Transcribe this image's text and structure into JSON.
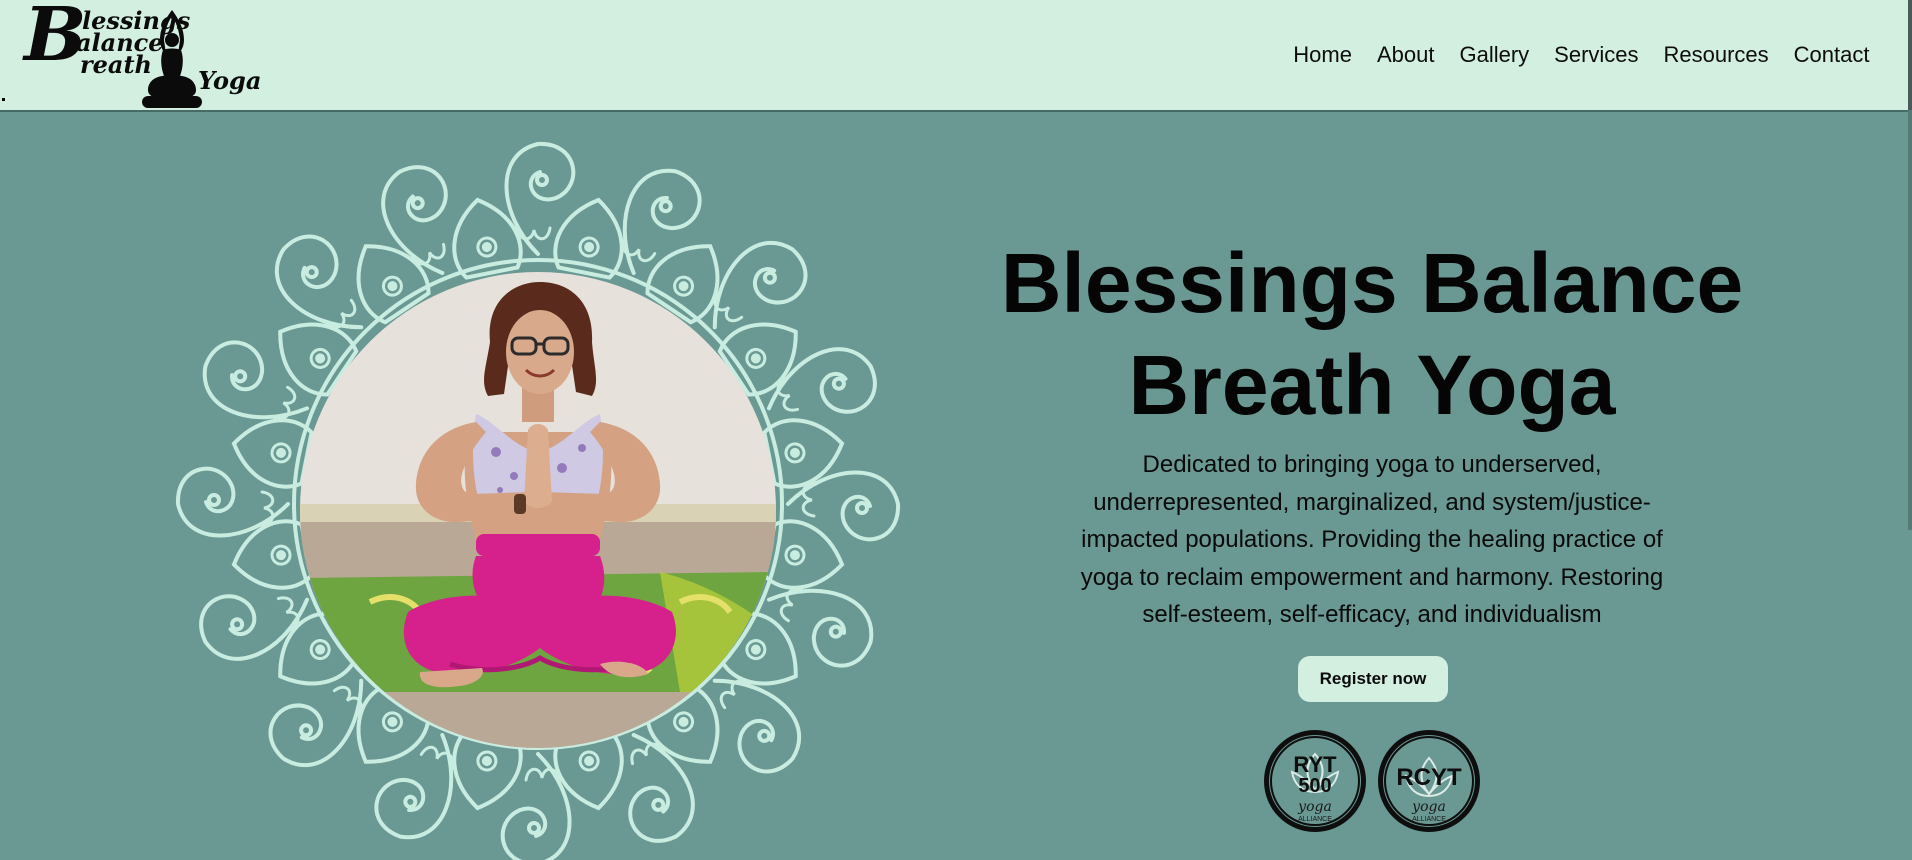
{
  "header": {
    "logo": {
      "big_letter": "B",
      "line1": "lessings",
      "line2": "alance",
      "line3": "reath",
      "line4": "Yoga"
    },
    "nav": [
      {
        "label": "Home"
      },
      {
        "label": "About"
      },
      {
        "label": "Gallery"
      },
      {
        "label": "Services"
      },
      {
        "label": "Resources"
      },
      {
        "label": "Contact"
      }
    ]
  },
  "hero": {
    "title": "Blessings Balance Breath Yoga",
    "description": "Dedicated to bringing yoga to underserved, underrepresented, marginalized, and system/justice-impacted populations. Providing the healing practice of yoga to reclaim empowerment and harmony. Restoring self-esteem, self-efficacy, and individualism",
    "register_label": "Register now",
    "badges": [
      {
        "line1": "RYT",
        "line2": "500",
        "line3": "yoga",
        "line4": "ALLIANCE"
      },
      {
        "line1": "RCYT",
        "line3": "yoga",
        "line4": "ALLIANCE"
      }
    ]
  },
  "colors": {
    "header_bg": "#d3efe0",
    "hero_bg": "#6a9893",
    "mandala_stroke": "#c9ece0",
    "button_bg": "#d3efe0",
    "text": "#0a0a0a"
  }
}
